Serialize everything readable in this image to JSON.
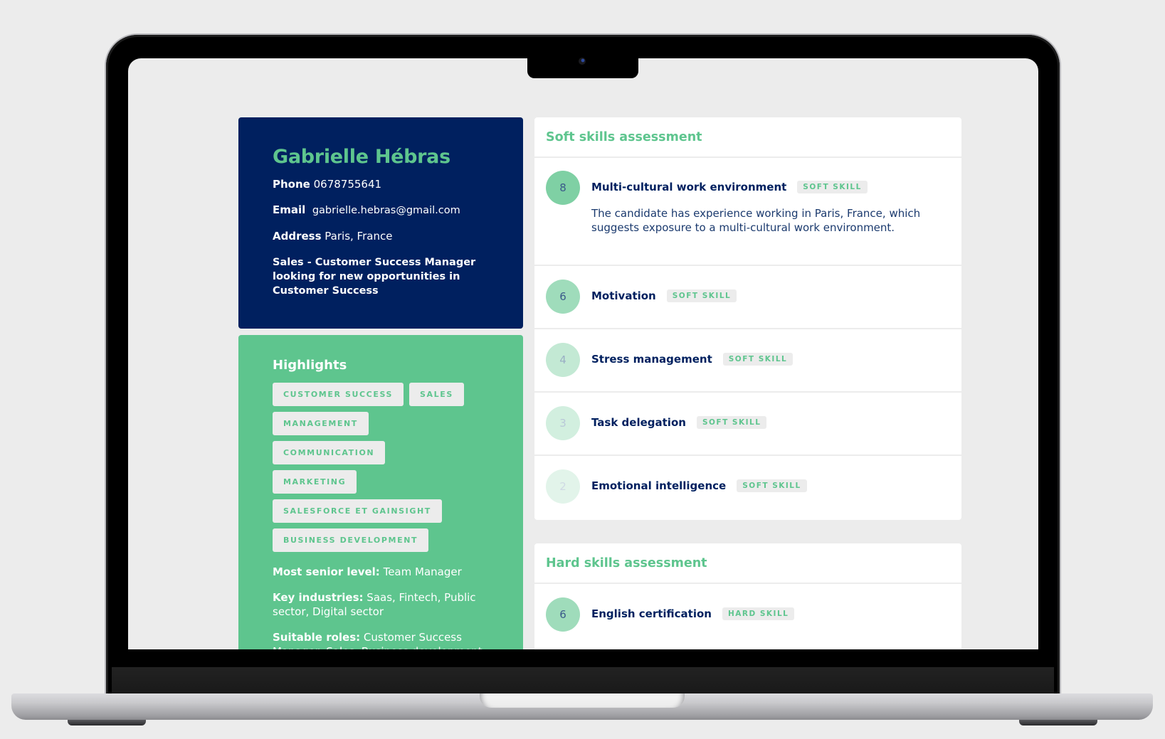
{
  "profile": {
    "name": "Gabrielle Hébras",
    "phone_label": "Phone",
    "phone": "0678755641",
    "email_label": "Email",
    "email": "gabrielle.hebras@gmail.com",
    "address_label": "Address",
    "address": "Paris, France",
    "headline": "Sales - Customer Success Manager looking for new opportunities in Customer Success"
  },
  "highlights": {
    "title": "Highlights",
    "tags": [
      "CUSTOMER SUCCESS",
      "SALES",
      "MANAGEMENT",
      "COMMUNICATION",
      "MARKETING",
      "SALESFORCE ET GAINSIGHT",
      "BUSINESS DEVELOPMENT"
    ],
    "senior_level_label": "Most senior level:",
    "senior_level": "Team Manager",
    "industries_label": "Key industries:",
    "industries": "Saas, Fintech, Public sector, Digital sector",
    "roles_label": "Suitable roles:",
    "roles": "Customer Success Manager, Sales, Business development, Public affairs officer"
  },
  "soft_skills": {
    "title": "Soft skills assessment",
    "items": [
      {
        "score": "8",
        "name": "Multi-cultural work environment",
        "badge": "SOFT SKILL",
        "description": "The candidate has experience working in Paris, France, which suggests exposure to a multi-cultural work environment."
      },
      {
        "score": "6",
        "name": "Motivation",
        "badge": "SOFT SKILL"
      },
      {
        "score": "4",
        "name": "Stress management",
        "badge": "SOFT SKILL"
      },
      {
        "score": "3",
        "name": "Task delegation",
        "badge": "SOFT SKILL"
      },
      {
        "score": "2",
        "name": "Emotional intelligence",
        "badge": "SOFT SKILL"
      }
    ]
  },
  "hard_skills": {
    "title": "Hard skills assessment",
    "items": [
      {
        "score": "6",
        "name": "English certification",
        "badge": "HARD SKILL"
      }
    ]
  },
  "colors": {
    "navy": "#00205f",
    "green": "#5ec58e",
    "score_8": "#7fd0a4",
    "score_6": "#9fdcbb",
    "score_4": "#c3e9d4",
    "score_3": "#d2efdf",
    "score_2": "#e2f4ea"
  }
}
